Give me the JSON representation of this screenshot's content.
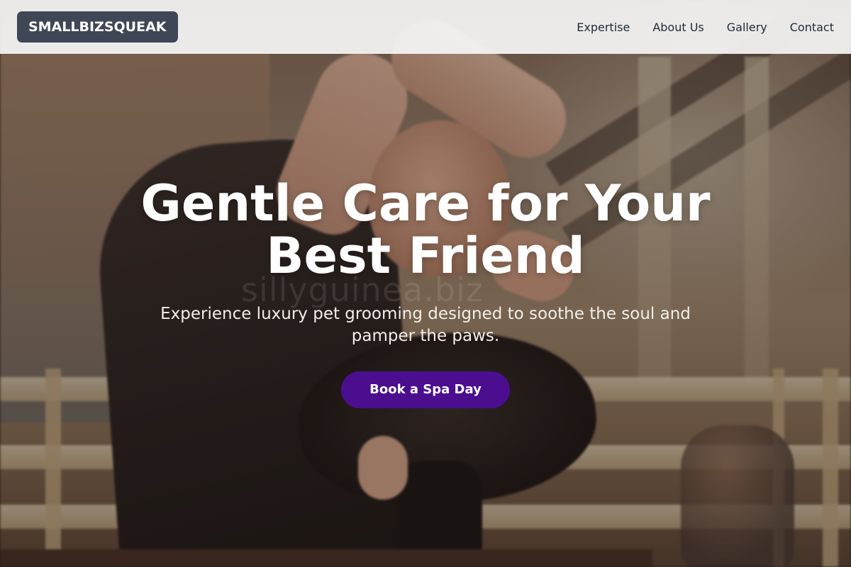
{
  "brand": {
    "name": "SMALLBIZSQUEAK"
  },
  "nav": {
    "links": [
      {
        "label": "Expertise"
      },
      {
        "label": "About Us"
      },
      {
        "label": "Gallery"
      },
      {
        "label": "Contact"
      }
    ]
  },
  "hero": {
    "title": "Gentle Care for Your Best Friend",
    "subtitle": "Experience luxury pet grooming designed to soothe the soul and pamper the paws.",
    "cta_label": "Book a Spa Day",
    "photo_watermark": "sillyguinea.biz",
    "photo_alt": "Groomer trimming a dark-coated animal in a barn"
  },
  "colors": {
    "nav_background": "#f5f5f5",
    "brand_background": "#3f4757",
    "cta_background": "#4a0e8f",
    "hero_text": "#ffffff"
  }
}
